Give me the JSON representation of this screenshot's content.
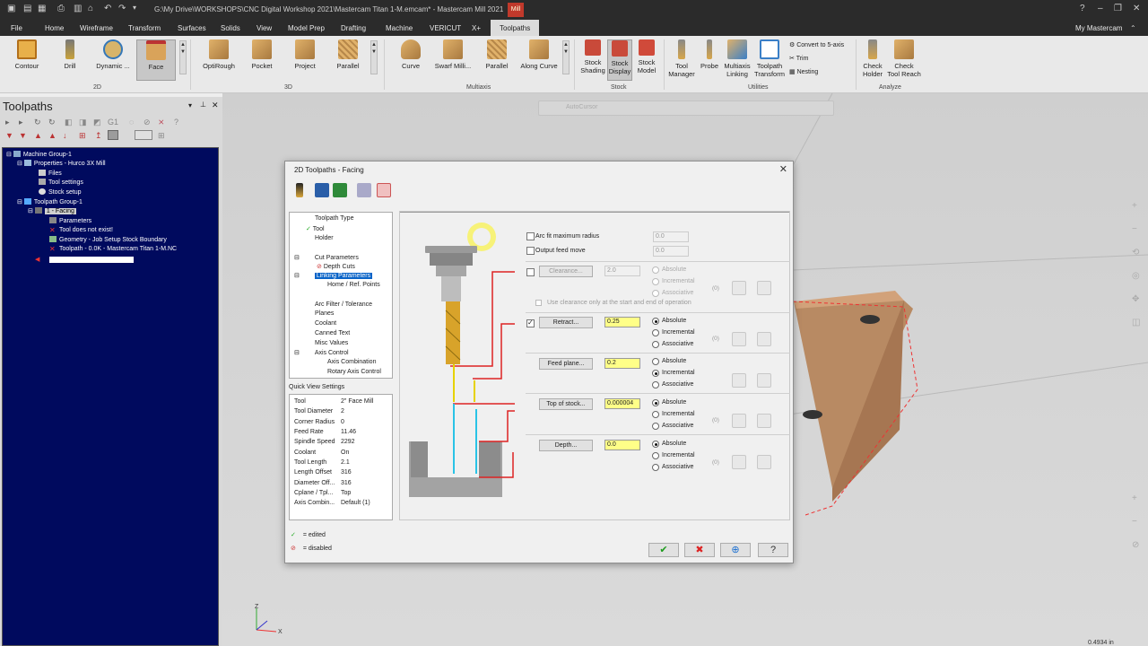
{
  "titlebar": {
    "title": "G:\\My Drive\\WORKSHOPS\\CNC Digital Workshop 2021\\Mastercam Titan 1-M.emcam* - Mastercam Mill 2021",
    "badge": "Mill"
  },
  "menu": {
    "items": [
      "File",
      "Home",
      "Wireframe",
      "Transform",
      "Surfaces",
      "Solids",
      "View",
      "Model Prep",
      "Drafting",
      "Machine",
      "VERICUT",
      "X+",
      "Toolpaths"
    ],
    "right_label": "My Mastercam"
  },
  "ribbon": {
    "buttons_2d": [
      "Contour",
      "Drill",
      "Dynamic ...",
      "Face"
    ],
    "group_2d": "2D",
    "buttons_3d": [
      "OptiRough",
      "Pocket",
      "Project",
      "Parallel"
    ],
    "group_3d": "3D",
    "buttons_multi": [
      "Curve",
      "Swarf Milli...",
      "Parallel",
      "Along Curve"
    ],
    "group_multi": "Multiaxis",
    "stock_btns": [
      [
        "Stock",
        "Shading"
      ],
      [
        "Stock",
        "Display"
      ],
      [
        "Stock",
        "Model"
      ]
    ],
    "group_stock": "Stock",
    "util_btns": [
      [
        "Tool",
        "Manager"
      ],
      [
        "Probe",
        ""
      ],
      [
        "Multiaxis",
        "Linking"
      ],
      [
        "Toolpath",
        "Transform"
      ]
    ],
    "util_small": [
      "Convert to 5-axis",
      "Trim",
      "Nesting"
    ],
    "group_util": "Utilities",
    "analyze_btns": [
      [
        "Check",
        "Holder"
      ],
      [
        "Check",
        "Tool Reach"
      ]
    ],
    "group_analyze": "Analyze"
  },
  "left_panel": {
    "title": "Toolpaths",
    "tree": [
      "Machine Group-1",
      "Properties - Hurco 3X Mill",
      "Files",
      "Tool settings",
      "Stock setup",
      "Toolpath Group-1",
      "1 - Facing",
      "Parameters",
      "Tool does not exist!",
      "Geometry - Job Setup Stock Boundary",
      "Toolpath - 0.0K - Mastercam Titan 1-M.NC"
    ]
  },
  "viewport": {
    "autocursor": "AutoCursor",
    "coord": "0.4934 in"
  },
  "dialog": {
    "title": "2D Toolpaths - Facing",
    "nav": [
      "Toolpath Type",
      "Tool",
      "Holder",
      "Cut Parameters",
      "Depth Cuts",
      "Linking Parameters",
      "Home / Ref. Points",
      "Arc Filter / Tolerance",
      "Planes",
      "Coolant",
      "Canned Text",
      "Misc Values",
      "Axis Control",
      "Axis Combination",
      "Rotary Axis Control"
    ],
    "quick_view_title": "Quick View Settings",
    "quick_view": [
      [
        "Tool",
        "2\" Face Mill"
      ],
      [
        "Tool Diameter",
        "2"
      ],
      [
        "Corner Radius",
        "0"
      ],
      [
        "Feed Rate",
        "11.46"
      ],
      [
        "Spindle Speed",
        "2292"
      ],
      [
        "Coolant",
        "On"
      ],
      [
        "Tool Length",
        "2.1"
      ],
      [
        "Length Offset",
        "316"
      ],
      [
        "Diameter Off...",
        "316"
      ],
      [
        "Cplane / Tpl...",
        "Top"
      ],
      [
        "Axis Combin...",
        "Default (1)"
      ]
    ],
    "legend_edited": "= edited",
    "legend_disabled": "= disabled",
    "arc_fit": "Arc fit maximum radius",
    "arc_fit_value": "0.0",
    "output_feed": "Output feed move",
    "output_feed_value": "0.0",
    "clearance_label": "Clearance...",
    "clearance_value": "2.0",
    "use_clearance": "Use clearance only at the start and end of operation",
    "retract_label": "Retract...",
    "retract_value": "0.25",
    "feed_label": "Feed plane...",
    "feed_value": "0.2",
    "top_label": "Top of stock...",
    "top_value": "0.000004",
    "depth_label": "Depth...",
    "depth_value": "0.0",
    "opt_absolute": "Absolute",
    "opt_incremental": "Incremental",
    "opt_associative": "Associative",
    "zero_tag": "(0)"
  },
  "colors": {
    "accent": "#e07a22",
    "tree_bg": "#000a5e",
    "highlight_yellow": "#ffff88"
  }
}
